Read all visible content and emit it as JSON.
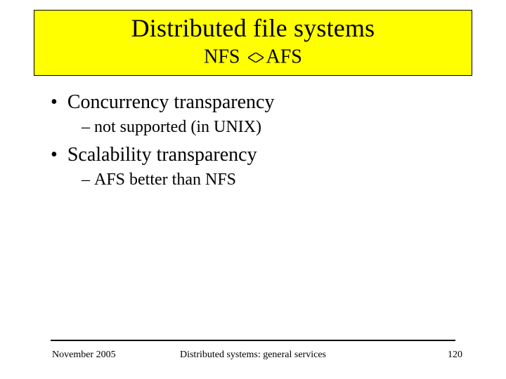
{
  "title": "Distributed file systems",
  "subtitle_left": "NFS ",
  "subtitle_right": "AFS",
  "bullets": [
    {
      "l1": "Concurrency transparency",
      "l2": "not supported (in UNIX)"
    },
    {
      "l1": "Scalability transparency",
      "l2": "AFS better than NFS"
    }
  ],
  "footer": {
    "left": "November 2005",
    "center": "Distributed systems: general services",
    "right": "120"
  }
}
